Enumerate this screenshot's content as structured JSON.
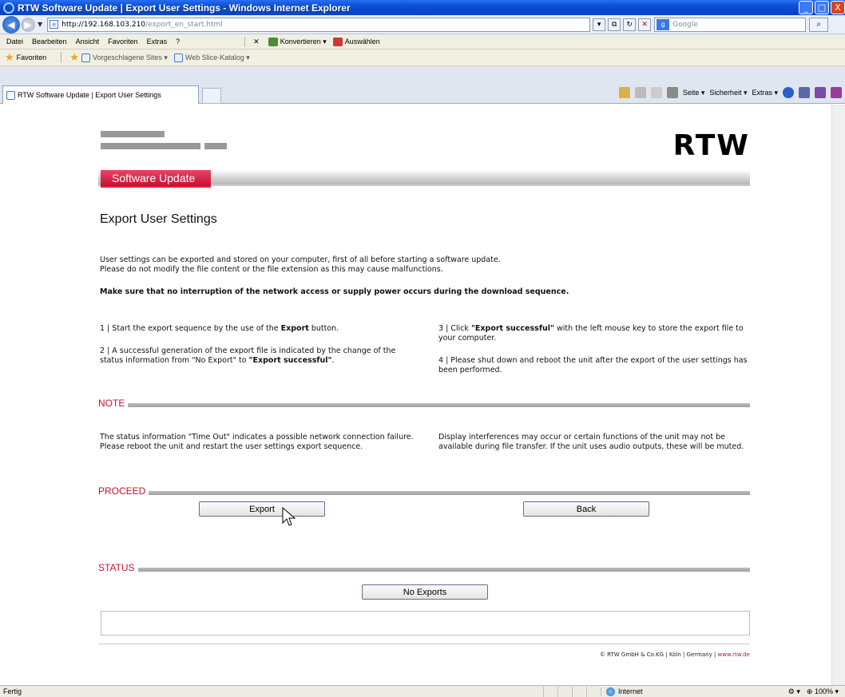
{
  "window": {
    "title": "RTW Software Update | Export User Settings - Windows Internet Explorer",
    "controls": [
      "_",
      "□",
      "X"
    ]
  },
  "address": {
    "url_host": "http://192.168.103.210",
    "url_path": "/export_en_start.html",
    "search_placeholder": "Google"
  },
  "menu": {
    "items": [
      "Datei",
      "Bearbeiten",
      "Ansicht",
      "Favoriten",
      "Extras",
      "?"
    ],
    "convert": "Konvertieren",
    "select": "Auswählen"
  },
  "favorites": {
    "label": "Favoriten",
    "items": [
      "Vorgeschlagene Sites ▾",
      "Web Slice-Katalog ▾"
    ]
  },
  "tabs": {
    "active": "RTW Software Update | Export User Settings"
  },
  "commandbar": {
    "page": "Seite ▾",
    "security": "Sicherheit ▾",
    "extras": "Extras ▾"
  },
  "page": {
    "logo": "RTW",
    "nav_tab": "Software Update",
    "title": "Export User Settings",
    "intro_1": "User settings can be exported and stored on your computer, first of all before starting a software update.",
    "intro_2": "Please do not modify the file content or the file extension as this may cause malfunctions.",
    "warning": "Make sure that no interruption of the network access or supply power occurs during the download sequence.",
    "step1_a": "1 | Start the export sequence by the use of the ",
    "step1_b": "Export",
    "step1_c": " button.",
    "step2_a": "2 | A successful generation of the export file is indicated by the change of the status information from \"No Export\" to ",
    "step2_b": "\"Export successful\"",
    "step2_c": ".",
    "step3_a": "3 | Click ",
    "step3_b": "\"Export successful\"",
    "step3_c": " with the left mouse key to store the export file to your computer.",
    "step4": "4 | Please shut down and reboot the unit after the export of the user settings has been performed.",
    "note_label": "NOTE",
    "note_left": "The status information \"Time Out\" indicates a possible network connection failure. Please reboot the unit and restart the user settings export sequence.",
    "note_right": "Display interferences may occur or certain functions of the unit may not be available during file transfer. If the unit uses audio outputs, these will be muted.",
    "proceed_label": "PROCEED",
    "export_button": "Export",
    "back_button": "Back",
    "status_label": "STATUS",
    "status_button": "No Exports",
    "copyright": "© RTW GmbH & Co.KG | Köln | Germany | ",
    "copyright_link": "www.rtw.de"
  },
  "statusbar": {
    "text": "Fertig",
    "zone": "Internet",
    "zoom": "100%"
  }
}
